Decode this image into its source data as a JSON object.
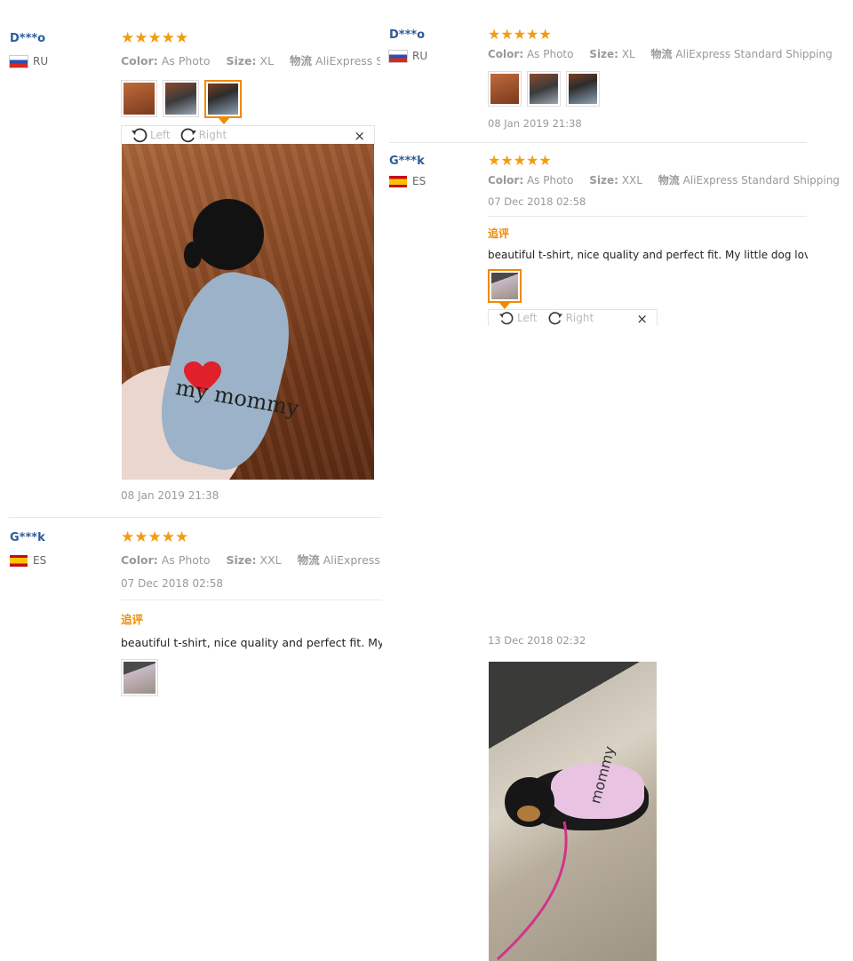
{
  "left": {
    "review1": {
      "user": "D***o",
      "country": "RU",
      "stars": "★★★★★",
      "color_label": "Color:",
      "color_value": "As Photo",
      "size_label": "Size:",
      "size_value": "XL",
      "ship_label": "物流",
      "ship_value": "AliExpress Standard Shipping",
      "viewer": {
        "left_label": "Left",
        "right_label": "Right",
        "close": "×"
      },
      "photo_text": "my mommy",
      "date": "08 Jan 2019 21:38"
    },
    "review2": {
      "user": "G***k",
      "country": "ES",
      "stars": "★★★★★",
      "color_label": "Color:",
      "color_value": "As Photo",
      "size_label": "Size:",
      "size_value": "XXL",
      "ship_label": "物流",
      "ship_value": "AliExpress Standard Shipping",
      "date": "07 Dec 2018 02:58",
      "additional_label": "追评",
      "text": "beautiful t-shirt, nice quality and perfect fit. My little dog loves it!"
    }
  },
  "right": {
    "review1": {
      "user": "D***o",
      "country": "RU",
      "stars": "★★★★★",
      "color_label": "Color:",
      "color_value": "As Photo",
      "size_label": "Size:",
      "size_value": "XL",
      "ship_label": "物流",
      "ship_value": "AliExpress Standard Shipping",
      "date": "08 Jan 2019 21:38"
    },
    "review2": {
      "user": "G***k",
      "country": "ES",
      "stars": "★★★★★",
      "color_label": "Color:",
      "color_value": "As Photo",
      "size_label": "Size:",
      "size_value": "XXL",
      "ship_label": "物流",
      "ship_value": "AliExpress Standard Shipping",
      "date": "07 Dec 2018 02:58",
      "additional_label": "追评",
      "text": "beautiful t-shirt, nice quality and perfect fit. My little dog loves it!",
      "viewer": {
        "left_label": "Left",
        "right_label": "Right",
        "close": "×"
      },
      "photo_text": "mommy",
      "photo_date": "13 Dec 2018 02:32"
    }
  },
  "colors": {
    "accent": "#f08a00",
    "star": "#f39c12",
    "username": "#2e5c9c",
    "muted": "#999999"
  }
}
